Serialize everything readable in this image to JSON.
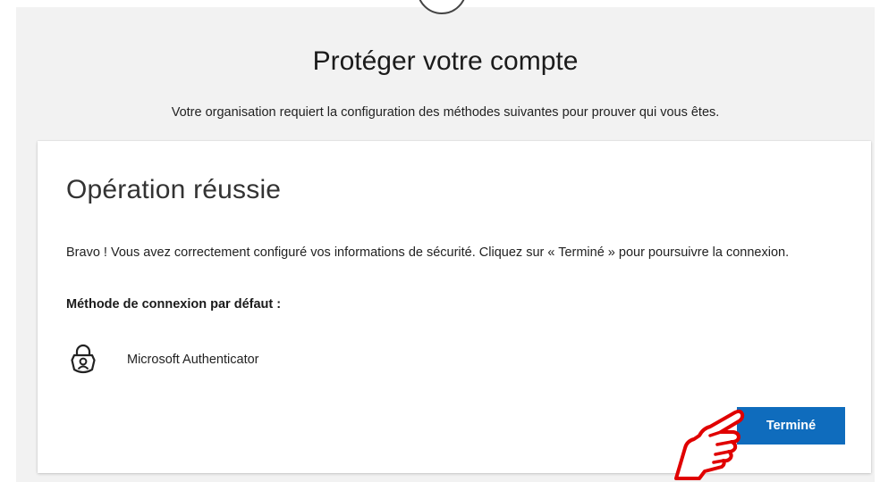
{
  "header": {
    "title": "Protéger votre compte",
    "subtitle": "Votre organisation requiert la configuration des méthodes suivantes pour prouver qui vous êtes."
  },
  "card": {
    "title": "Opération réussie",
    "message": "Bravo ! Vous avez correctement configuré vos informations de sécurité. Cliquez sur « Terminé » pour poursuivre la connexion.",
    "default_method_label": "Méthode de connexion par défaut :",
    "method": {
      "icon": "authenticator-lock-icon",
      "label": "Microsoft Authenticator"
    },
    "done_button_label": "Terminé"
  },
  "colors": {
    "page_background": "#f2f2f2",
    "card_background": "#ffffff",
    "primary_button": "#0f6cbd",
    "pointer_annotation": "#e00000"
  }
}
